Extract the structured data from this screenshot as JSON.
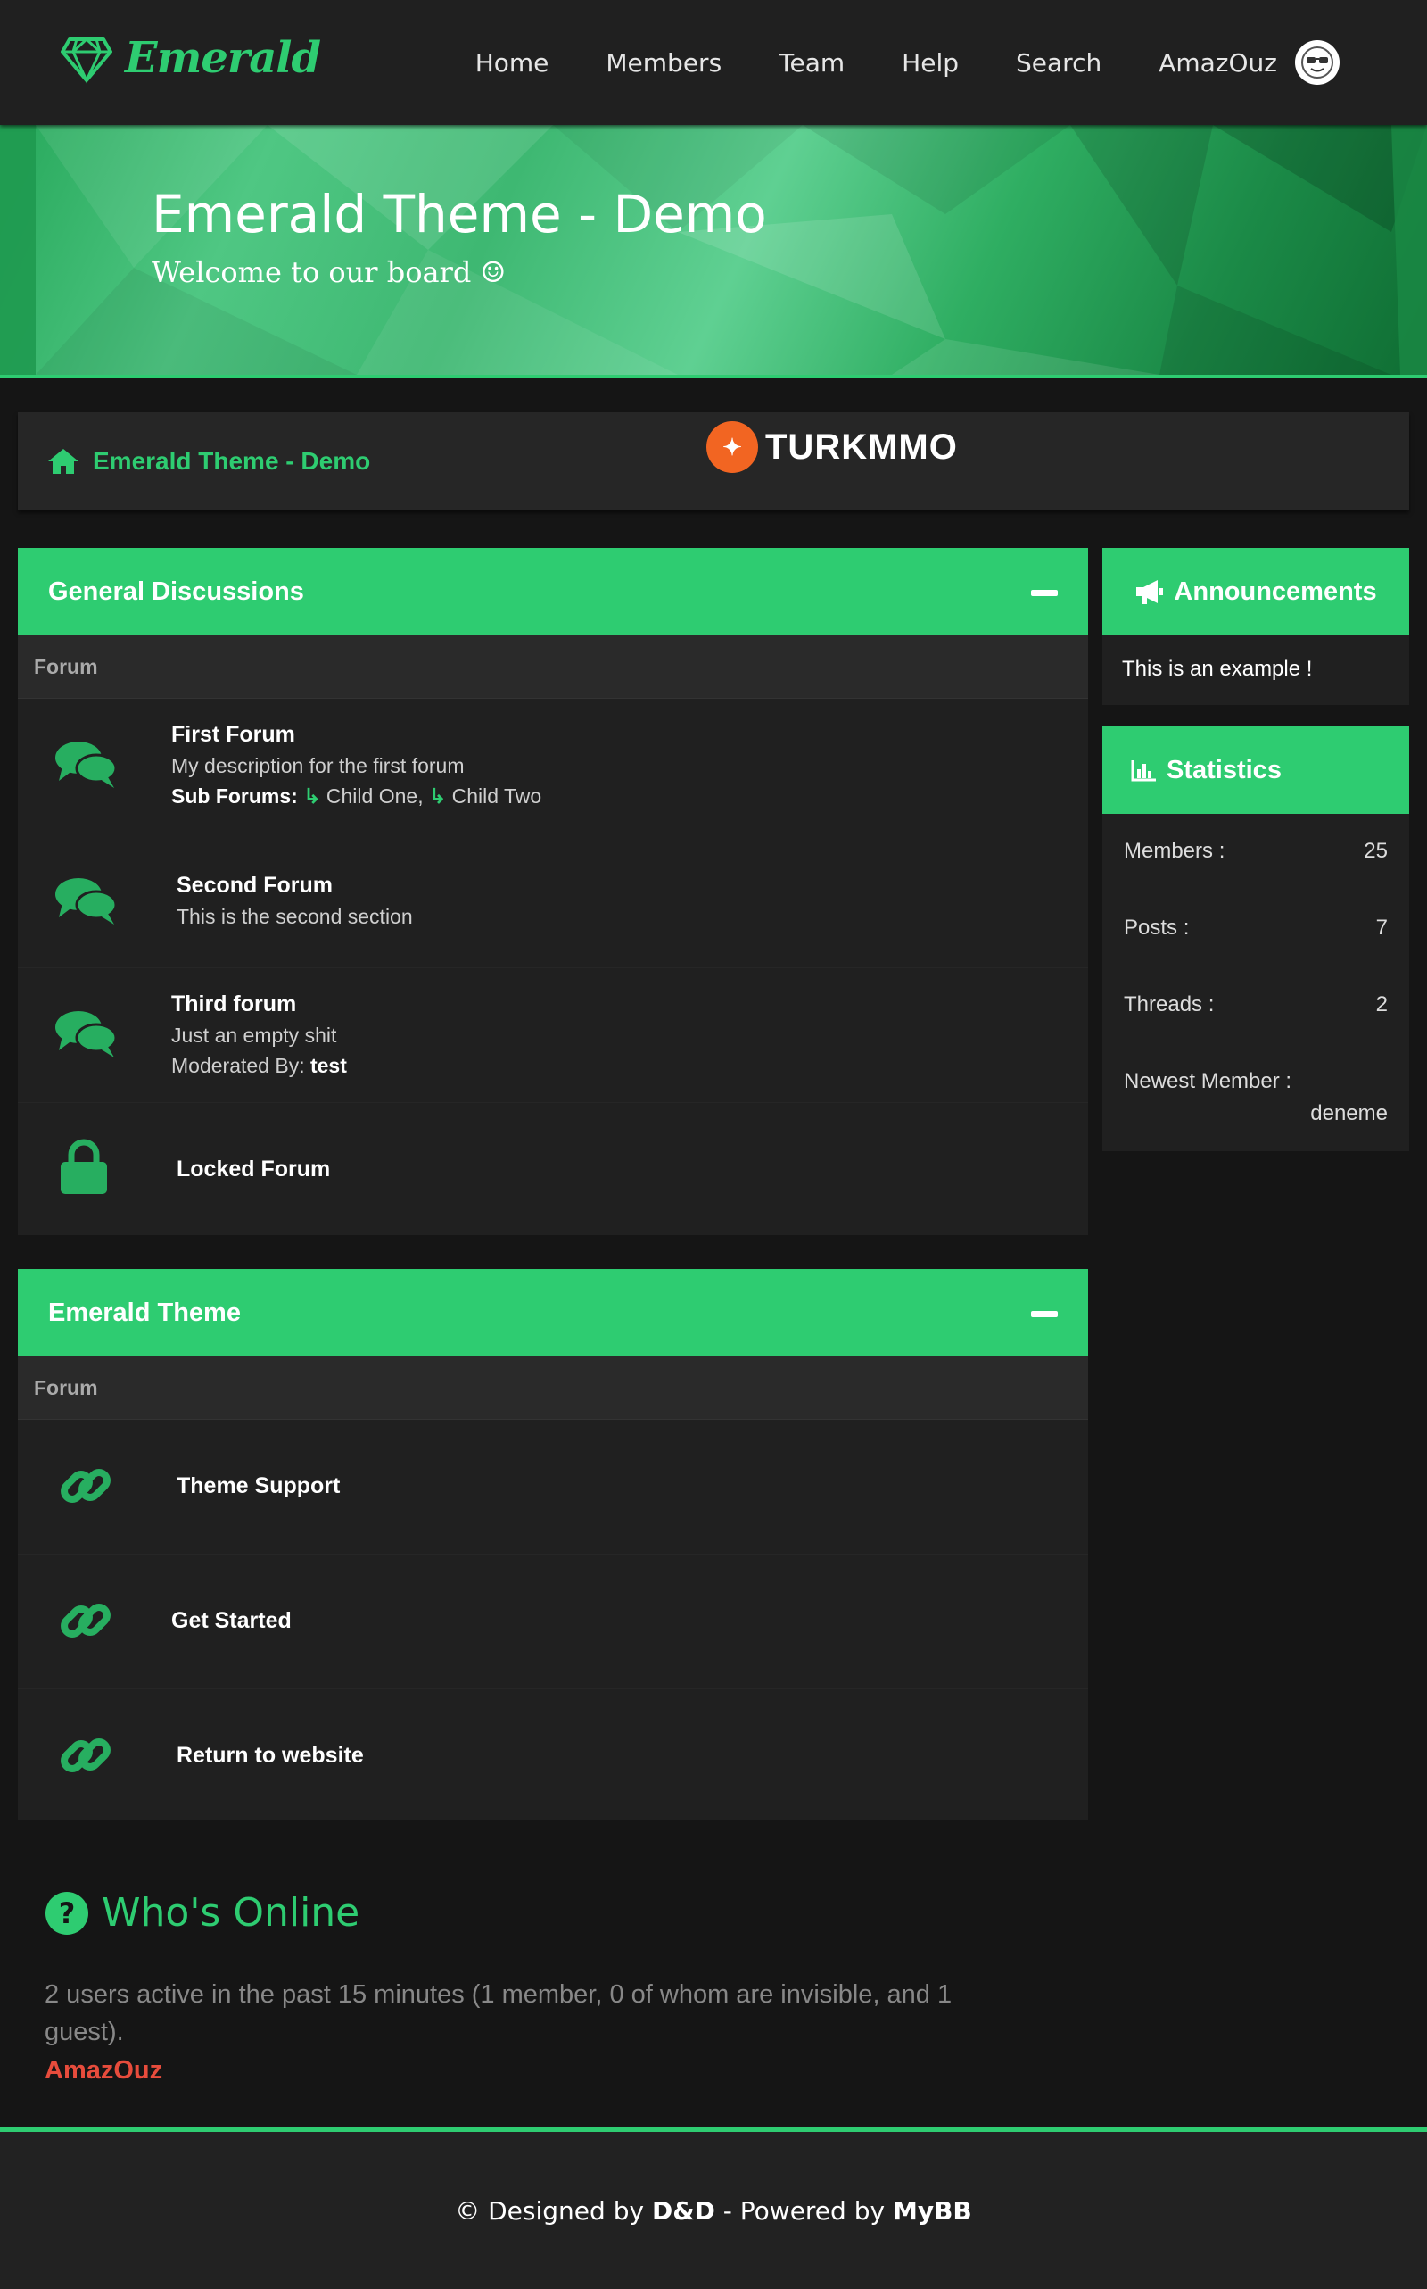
{
  "brand": {
    "name": "Emerald"
  },
  "nav": {
    "items": [
      {
        "label": "Home"
      },
      {
        "label": "Members"
      },
      {
        "label": "Team"
      },
      {
        "label": "Help"
      },
      {
        "label": "Search"
      }
    ],
    "user": "AmazOuz"
  },
  "banner": {
    "title": "Emerald Theme - Demo",
    "subtitle": "Welcome to our board ☺"
  },
  "breadcrumb": {
    "label": "Emerald Theme - Demo"
  },
  "promo": {
    "text": "TURKMMO"
  },
  "categories": [
    {
      "title": "General Discussions",
      "column": "Forum",
      "forums": [
        {
          "name": "First Forum",
          "description": "My description for the first forum",
          "subforums_label": "Sub Forums:",
          "subforums": [
            "Child One",
            "Child Two"
          ]
        },
        {
          "name": "Second Forum",
          "description": "This is the second section"
        },
        {
          "name": "Third forum",
          "description": "Just an empty shit",
          "moderated_label": "Moderated By:",
          "moderator": "test"
        },
        {
          "name": "Locked Forum"
        }
      ]
    },
    {
      "title": "Emerald Theme",
      "column": "Forum",
      "forums": [
        {
          "name": "Theme Support"
        },
        {
          "name": "Get Started"
        },
        {
          "name": "Return to website"
        }
      ]
    }
  ],
  "announcements": {
    "title": "Announcements",
    "text": "This is an example !"
  },
  "statistics": {
    "title": "Statistics",
    "members_label": "Members :",
    "members": "25",
    "posts_label": "Posts :",
    "posts": "7",
    "threads_label": "Threads :",
    "threads": "2",
    "newest_label": "Newest Member :",
    "newest": "deneme"
  },
  "online": {
    "title": "Who's Online",
    "text": "2 users active in the past 15 minutes (1 member, 0 of whom are invisible, and 1 guest).",
    "user": "AmazOuz"
  },
  "footer": {
    "prefix": "© Designed by",
    "designer": "D&D",
    "middle": "- Powered by",
    "engine": "MyBB"
  },
  "colors": {
    "accent": "#2ecc71",
    "background": "#151515",
    "panel": "#202020",
    "online_user": "#e74c3c"
  },
  "icons": [
    "diamond-icon",
    "home-icon",
    "chat-bubbles-icon",
    "lock-icon",
    "link-icon",
    "megaphone-icon",
    "bar-chart-icon",
    "question-circle-icon",
    "sunglasses-avatar-icon"
  ]
}
